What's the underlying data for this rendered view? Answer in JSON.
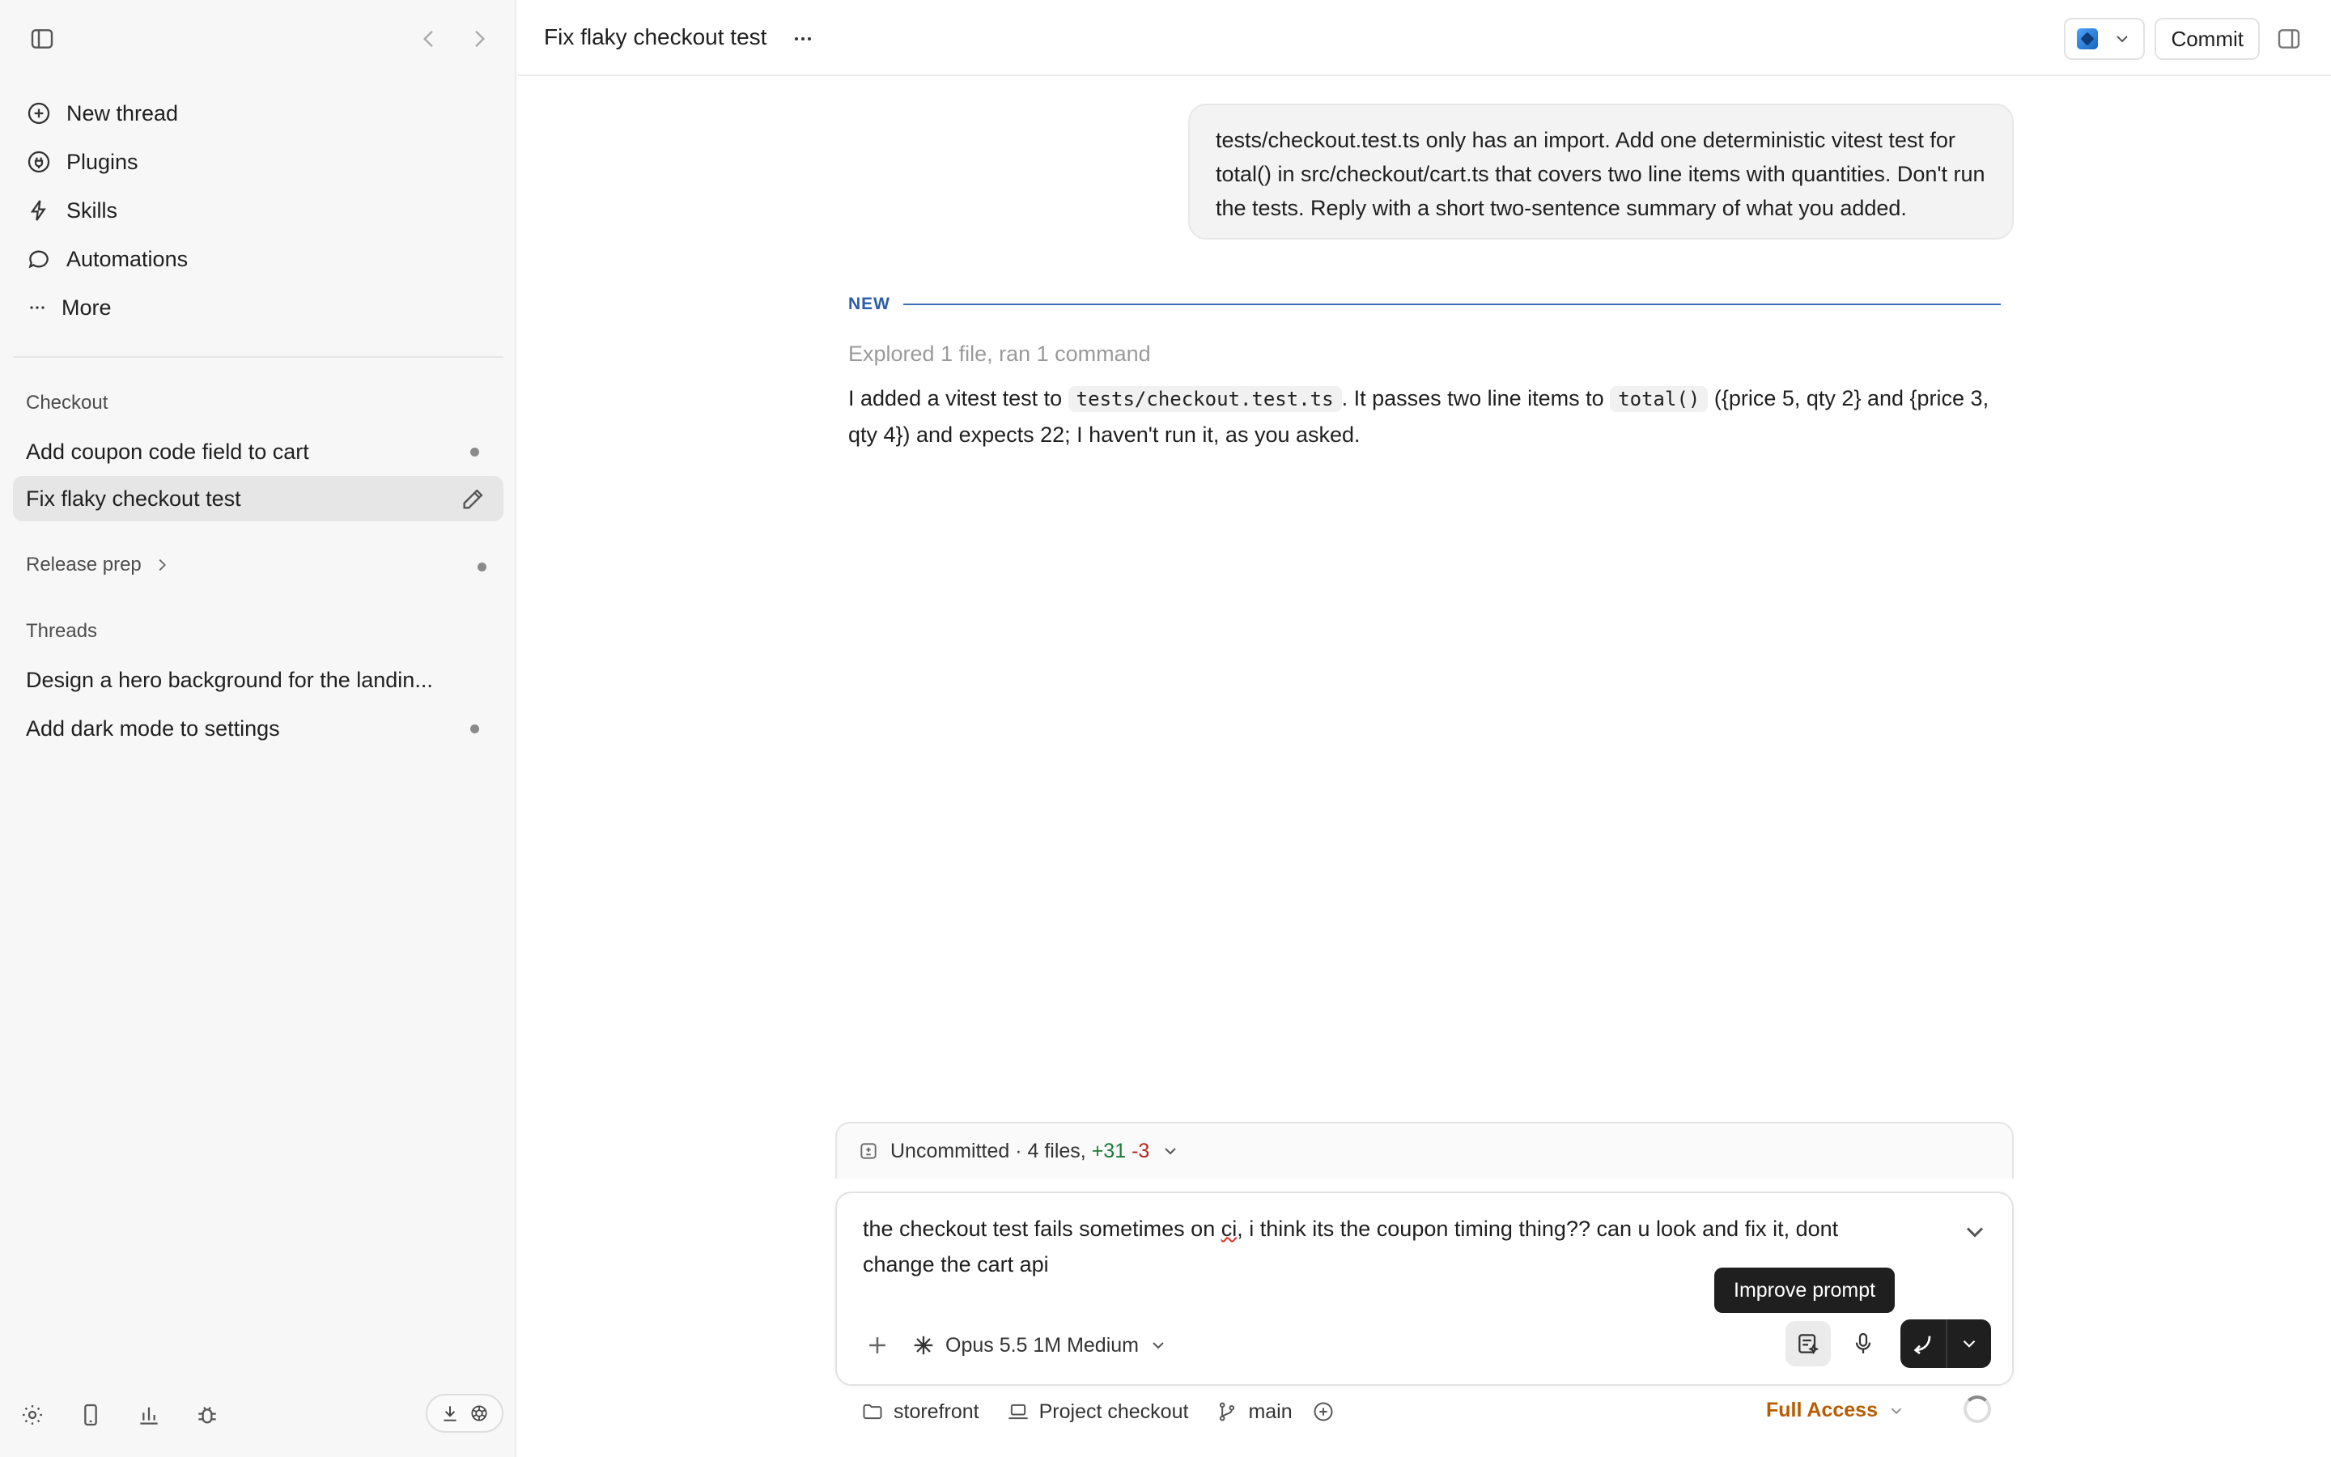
{
  "sidebar": {
    "nav": [
      {
        "label": "New thread",
        "icon": "plus-circle-icon"
      },
      {
        "label": "Plugins",
        "icon": "plugin-icon"
      },
      {
        "label": "Skills",
        "icon": "lightning-icon"
      },
      {
        "label": "Automations",
        "icon": "chat-bubble-icon"
      },
      {
        "label": "More",
        "icon": "ellipsis-icon"
      }
    ],
    "project_section": "Checkout",
    "project_threads": [
      {
        "title": "Add coupon code field to cart"
      },
      {
        "title": "Fix flaky checkout test"
      }
    ],
    "release_section": "Release prep",
    "threads_section": "Threads",
    "threads": [
      {
        "title": "Design a hero background for the landin..."
      },
      {
        "title": "Add dark mode to settings"
      }
    ]
  },
  "topbar": {
    "title": "Fix flaky checkout test",
    "commit_label": "Commit"
  },
  "conversation": {
    "user_message": "tests/checkout.test.ts only has an import. Add one deterministic vitest test for total() in src/checkout/cart.ts that covers two line items with quantities. Don't run the tests. Reply with a short two-sentence summary of what you added.",
    "divider_label": "NEW",
    "explored": "Explored 1 file, ran 1 command",
    "assistant": {
      "part1": "I added a vitest test to ",
      "code1": "tests/checkout.test.ts",
      "part2": ". It passes two line items to ",
      "code2": "total()",
      "part3": " ({price 5, qty 2} and {price 3, qty 4}) and expects 22; I haven't run it, as you asked."
    }
  },
  "uncommitted": {
    "label": "Uncommitted · 4 files, ",
    "additions": "+31",
    "deletions": "-3"
  },
  "composer": {
    "text_before": "the checkout test fails sometimes on ",
    "text_misspelled": "ci",
    "text_after": ", i think its the coupon timing thing?? can u look and fix it, dont change the cart api",
    "model": "Opus 5.5 1M Medium",
    "tooltip": "Improve prompt"
  },
  "footer": {
    "repo": "storefront",
    "project": "Project checkout",
    "branch": "main",
    "access": "Full Access"
  },
  "colors": {
    "accent_blue": "#2b5da8",
    "additions_green": "#1d7a36",
    "deletions_red": "#b3261e",
    "access_orange": "#b85c00"
  }
}
